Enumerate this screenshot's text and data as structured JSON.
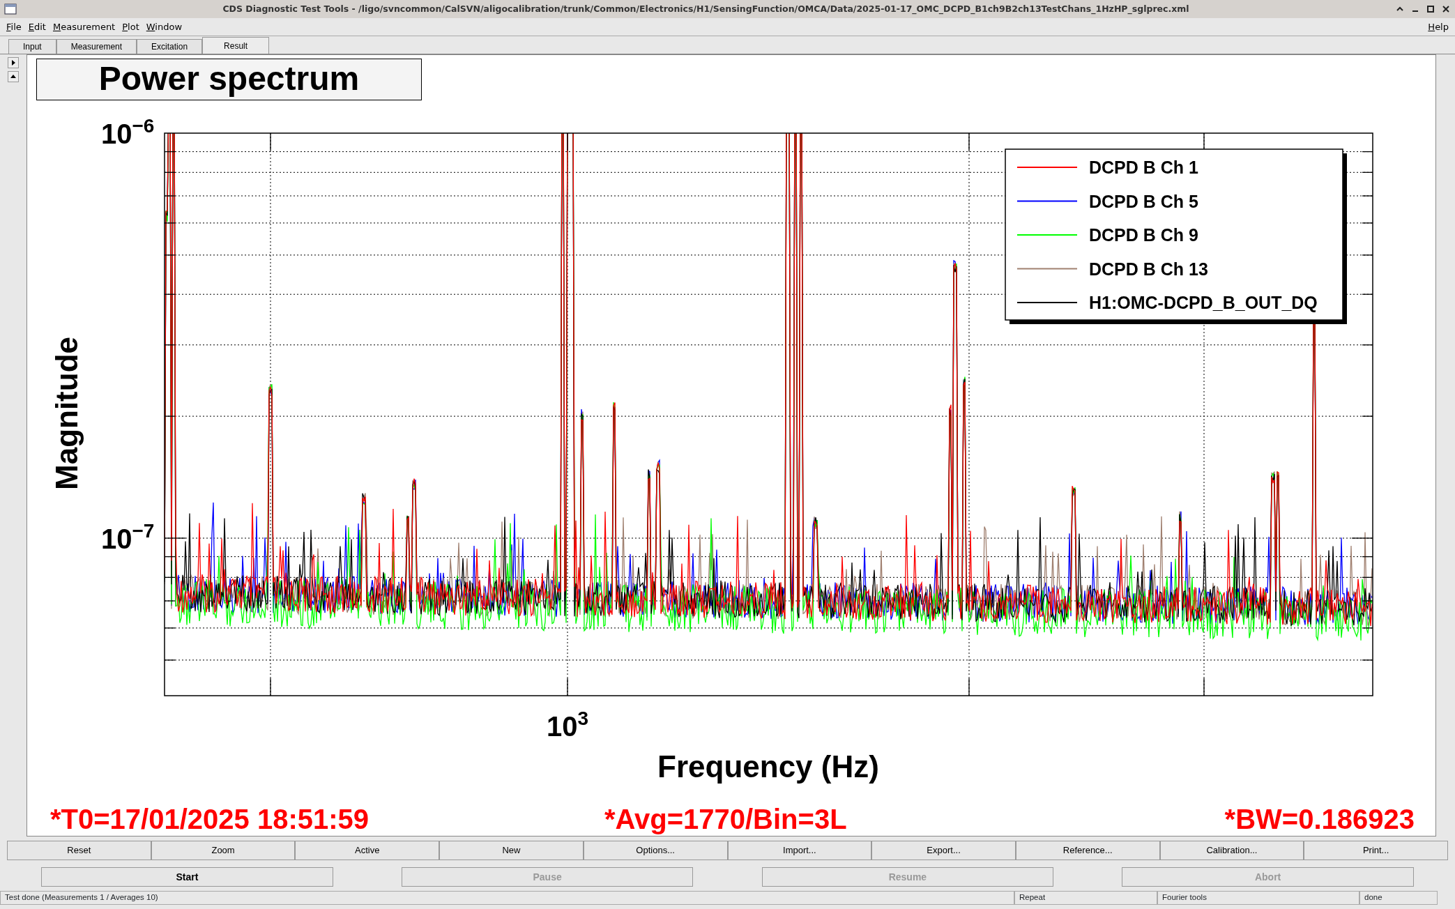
{
  "window": {
    "title": "CDS Diagnostic Test Tools - /ligo/svncommon/CalSVN/aligocalibration/trunk/Common/Electronics/H1/SensingFunction/OMCA/Data/2025-01-17_OMC_DCPD_B1ch9B2ch13TestChans_1HzHP_sglprec.xml"
  },
  "menu": [
    {
      "label": "File"
    },
    {
      "label": "Edit"
    },
    {
      "label": "Measurement"
    },
    {
      "label": "Plot"
    },
    {
      "label": "Window"
    }
  ],
  "help_menu": {
    "label": "Help"
  },
  "tabs": [
    {
      "label": "Input",
      "selected": false
    },
    {
      "label": "Measurement",
      "selected": false
    },
    {
      "label": "Excitation",
      "selected": false
    },
    {
      "label": "Result",
      "selected": true
    }
  ],
  "plot": {
    "title": "Power spectrum",
    "ylabel": "Magnitude",
    "xlabel": "Frequency (Hz)",
    "yticks": [
      "10$^{−6}$",
      "10$^{−7}$"
    ],
    "xticks": [
      "10$^{3}$"
    ],
    "legend": [
      {
        "label": "DCPD B Ch 1",
        "color": "#ff0000"
      },
      {
        "label": "DCPD B Ch 5",
        "color": "#0000ff"
      },
      {
        "label": "DCPD B Ch 9",
        "color": "#00ff00"
      },
      {
        "label": "DCPD B Ch 13",
        "color": "#a08070"
      },
      {
        "label": "H1:OMC-DCPD_B_OUT_DQ",
        "color": "#000000"
      }
    ],
    "info": [
      "*T0=17/01/2025 18:51:59",
      "*Avg=1770/Bin=3L",
      "*BW=0.186923"
    ]
  },
  "plot_buttons": [
    "Reset",
    "Zoom",
    "Active",
    "New",
    "Options...",
    "Import...",
    "Export...",
    "Reference...",
    "Calibration...",
    "Print..."
  ],
  "run_buttons": [
    {
      "label": "Start",
      "disabled": false
    },
    {
      "label": "Pause",
      "disabled": true
    },
    {
      "label": "Resume",
      "disabled": true
    },
    {
      "label": "Abort",
      "disabled": true
    }
  ],
  "status_bar": {
    "message": "Test done (Measurements 1 / Averages 10)",
    "fields": [
      "Repeat",
      "Fourier tools",
      "done"
    ]
  }
}
